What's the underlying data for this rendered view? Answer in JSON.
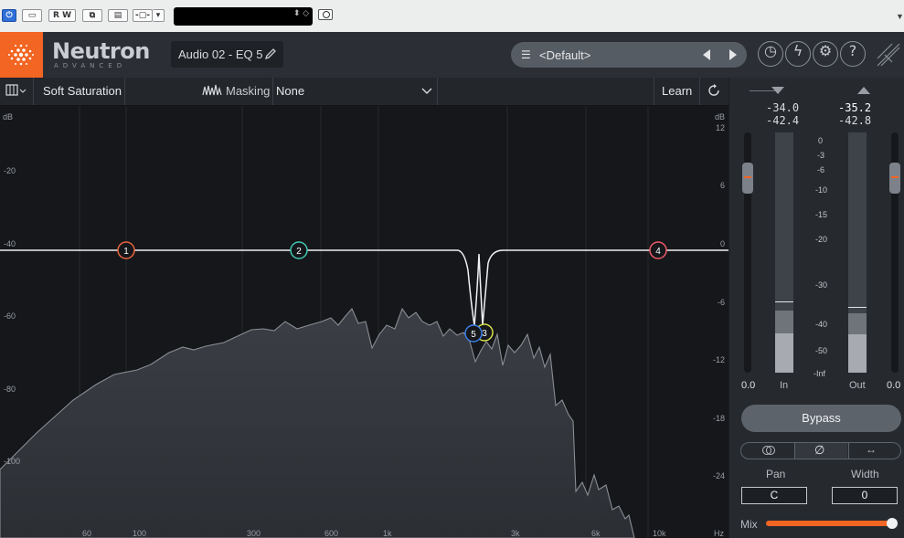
{
  "host": {
    "toolbar_buttons": [
      "R",
      "W"
    ],
    "icons": [
      "power-icon",
      "compare-icon",
      "read-write-icon",
      "ab-icon",
      "copy-icon",
      "routing-icon",
      "dropdown-icon",
      "camera-icon",
      "menu-arrow-icon"
    ]
  },
  "header": {
    "app_name": "Neutron",
    "edition": "ADVANCED",
    "instance_name": "Audio 02 - EQ 5",
    "preset": "<Default>",
    "brand_color": "#f26522"
  },
  "module_bar": {
    "module_name": "Soft Saturation",
    "masking_label": "Masking",
    "masking_value": "None",
    "learn_label": "Learn"
  },
  "eq": {
    "left_axis": {
      "unit": "dB",
      "ticks": [
        "-20",
        "-40",
        "-60",
        "-80",
        "-100"
      ]
    },
    "right_axis": {
      "unit": "dB",
      "ticks": [
        "12",
        "6",
        "0",
        "-6",
        "-12",
        "-18",
        "-24"
      ]
    },
    "freq_ticks": [
      "60",
      "100",
      "300",
      "600",
      "1k",
      "3k",
      "6k",
      "10k"
    ],
    "freq_unit": "Hz",
    "nodes": [
      {
        "label": "1",
        "color": "#e8643c"
      },
      {
        "label": "2",
        "color": "#3fc7b1"
      },
      {
        "label": "3",
        "color": "#d7e04a"
      },
      {
        "label": "4",
        "color": "#f05a6a"
      },
      {
        "label": "5",
        "color": "#3d7ee8"
      }
    ]
  },
  "meters": {
    "input_peak": "-34.0",
    "input_rms": "-42.4",
    "output_peak": "-35.2",
    "output_rms": "-42.8",
    "scale": [
      "0",
      "-3",
      "-6",
      "-10",
      "-15",
      "-20",
      "-30",
      "-40",
      "-50",
      "-Inf"
    ],
    "in_label": "In",
    "out_label": "Out",
    "input_gain": "0.0",
    "output_gain": "0.0",
    "bypass_label": "Bypass",
    "pan_label": "Pan",
    "pan_value": "C",
    "width_label": "Width",
    "width_value": "0",
    "mix_label": "Mix",
    "mix_level": 1.0
  }
}
